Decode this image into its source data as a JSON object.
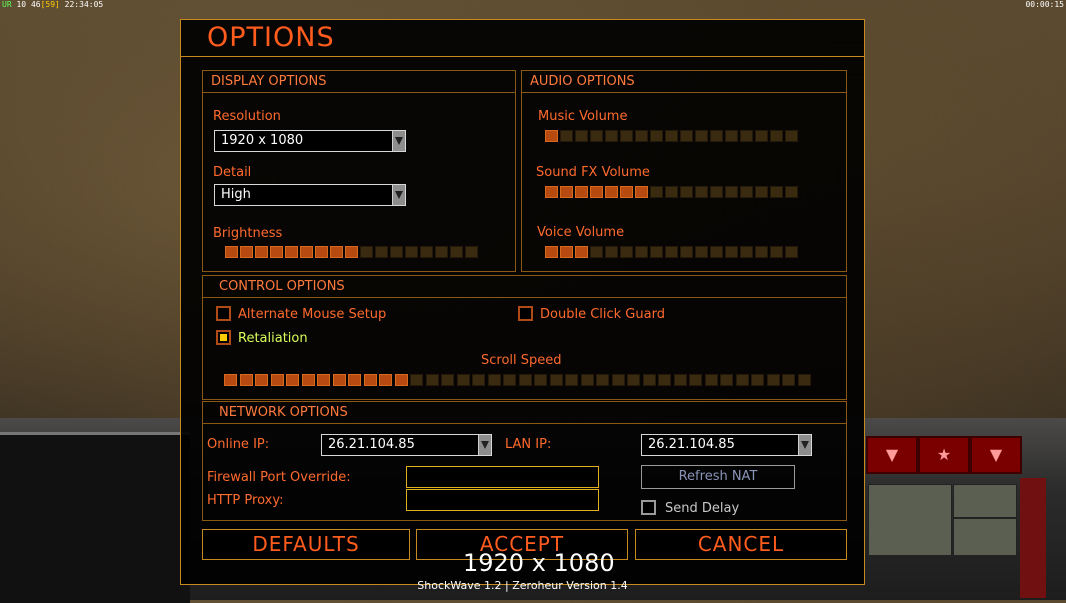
{
  "hud": {
    "ur": "UR",
    "stat1": "10",
    "stat2": "46",
    "fps": "[59]",
    "clock": "22:34:05",
    "game_timer": "00:00:15"
  },
  "dialog": {
    "title": "OPTIONS",
    "display": {
      "header": "DISPLAY OPTIONS",
      "resolution_label": "Resolution",
      "resolution_value": "1920 x 1080",
      "detail_label": "Detail",
      "detail_value": "High",
      "brightness_label": "Brightness",
      "brightness_level": 9,
      "brightness_max": 17
    },
    "audio": {
      "header": "AUDIO OPTIONS",
      "music_label": "Music Volume",
      "music_level": 1,
      "music_max": 17,
      "sfx_label": "Sound FX Volume",
      "sfx_level": 7,
      "sfx_max": 17,
      "voice_label": "Voice Volume",
      "voice_level": 3,
      "voice_max": 17
    },
    "control": {
      "header": "CONTROL OPTIONS",
      "alt_mouse_label": "Alternate Mouse Setup",
      "alt_mouse_checked": false,
      "double_click_label": "Double Click Guard",
      "double_click_checked": false,
      "retaliation_label": "Retaliation",
      "retaliation_checked": true,
      "scroll_speed_label": "Scroll Speed",
      "scroll_level": 12,
      "scroll_max": 38
    },
    "network": {
      "header": "NETWORK OPTIONS",
      "online_ip_label": "Online IP:",
      "online_ip_value": "26.21.104.85",
      "lan_ip_label": "LAN IP:",
      "lan_ip_value": "26.21.104.85",
      "firewall_label": "Firewall Port Override:",
      "firewall_value": "",
      "proxy_label": "HTTP Proxy:",
      "proxy_value": "",
      "refresh_nat_label": "Refresh NAT",
      "send_delay_label": "Send Delay",
      "send_delay_checked": false
    },
    "buttons": {
      "defaults": "DEFAULTS",
      "accept": "ACCEPT",
      "cancel": "CANCEL"
    },
    "footer": "ShockWave 1.2 | Zeroheur Version 1.4",
    "resolution_overlay": "1920 x 1080"
  },
  "colors": {
    "accent": "#ff5c1e",
    "border": "#c68a1e",
    "slider_on": "#b74a10",
    "slider_off": "#3a2a10"
  }
}
